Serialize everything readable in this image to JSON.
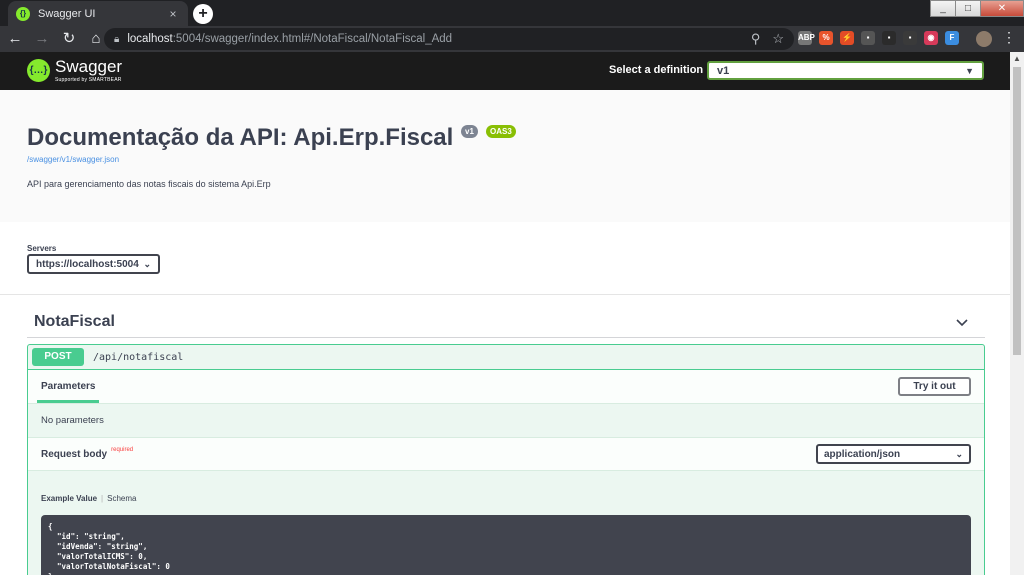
{
  "browser": {
    "tab_title": "Swagger UI",
    "tab_close": "×",
    "new_tab": "+",
    "url_host": "localhost",
    "url_rest": ":5004/swagger/index.html#/NotaFiscal/NotaFiscal_Add",
    "window_minimize": "_",
    "window_maximize": "□",
    "window_close": "✕"
  },
  "swagger_header": {
    "logo_name": "Swagger",
    "logo_sub": "Supported by SMARTBEAR",
    "definition_label": "Select a definition",
    "definition_value": "v1"
  },
  "info": {
    "title": "Documentação da API: Api.Erp.Fiscal",
    "version_badge": "v1",
    "oas_badge": "OAS3",
    "spec_url": "/swagger/v1/swagger.json",
    "description": "API para gerenciamento das notas fiscais do sistema Api.Erp"
  },
  "servers": {
    "label": "Servers",
    "selected": "https://localhost:5004"
  },
  "tag": {
    "name": "NotaFiscal"
  },
  "operation": {
    "method": "POST",
    "path": "/api/notafiscal",
    "parameters_tab": "Parameters",
    "try_it_out": "Try it out",
    "no_parameters": "No parameters",
    "request_body_label": "Request body",
    "required_label": "required",
    "content_type": "application/json",
    "example_value_tab": "Example Value",
    "schema_tab": "Schema",
    "example_code": "{\n  \"id\": \"string\",\n  \"idVenda\": \"string\",\n  \"valorTotalICMS\": 0,\n  \"valorTotalNotaFiscal\": 0\n}"
  },
  "colors": {
    "post_green": "#49cc90",
    "topbar_bg": "#1b1b1b",
    "swagger_green": "#85ea2d",
    "oas_green": "#89bf04",
    "text_dark": "#3b4151"
  }
}
